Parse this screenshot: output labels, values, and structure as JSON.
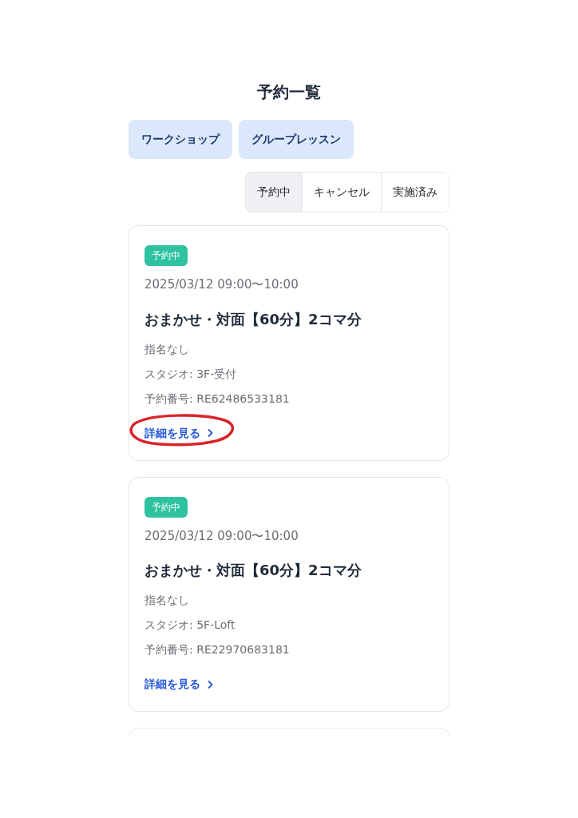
{
  "title": "予約一覧",
  "categories": [
    {
      "label": "ワークショップ"
    },
    {
      "label": "グループレッスン"
    }
  ],
  "status_tabs": [
    {
      "label": "予約中",
      "selected": true
    },
    {
      "label": "キャンセル",
      "selected": false
    },
    {
      "label": "実施済み",
      "selected": false
    }
  ],
  "cards": [
    {
      "kind": "full",
      "badge": "予約中",
      "datetime": "2025/03/12 09:00〜10:00",
      "title": "おまかせ・対面【60分】2コマ分",
      "staff": "指名なし",
      "studio": "スタジオ: 3F-受付",
      "number": "予約番号: RE62486533181",
      "link": "詳細を見る",
      "link_circled": true
    },
    {
      "kind": "full",
      "badge": "予約中",
      "datetime": "2025/03/12 09:00〜10:00",
      "title": "おまかせ・対面【60分】2コマ分",
      "staff": "指名なし",
      "studio": "スタジオ: 5F-Loft",
      "number": "予約番号: RE22970683181",
      "link": "詳細を見る",
      "link_circled": false
    },
    {
      "kind": "cut"
    }
  ]
}
